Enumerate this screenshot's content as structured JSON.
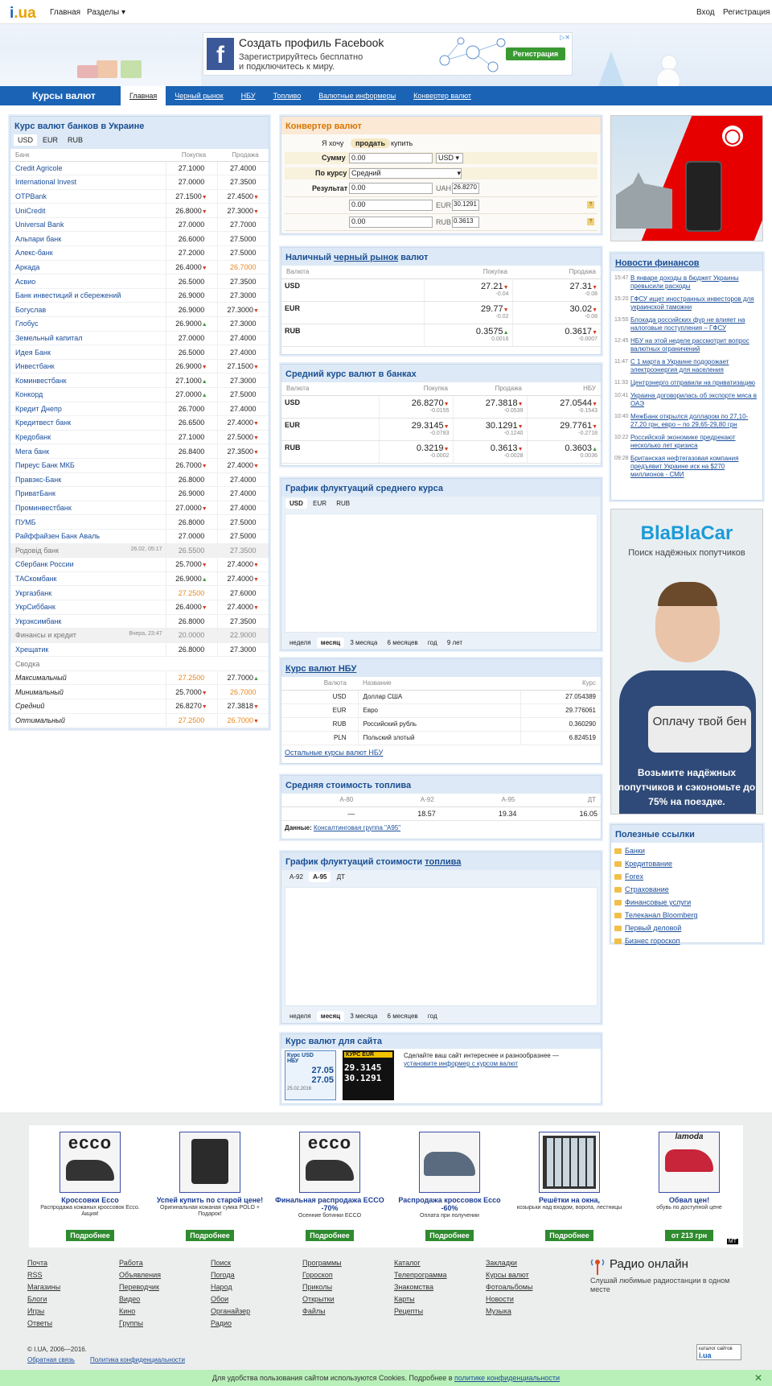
{
  "topbar": {
    "logo_i": "i",
    "logo_ua": ".ua",
    "home": "Главная",
    "sections": "Разделы ▾",
    "login": "Вход",
    "register": "Регистрация"
  },
  "banner": {
    "fb_title": "Создать профиль Facebook",
    "fb_line1": "Зарегистрируйтесь бесплатно",
    "fb_line2": "и подключитесь к миру.",
    "fb_button": "Регистрация",
    "fb_icon": "f"
  },
  "nav": {
    "section": "Курсы валют",
    "tabs": [
      "Главная",
      "Черный рынок",
      "НБУ",
      "Топливо",
      "Валютные информеры",
      "Конвертер валют"
    ]
  },
  "banks": {
    "title": "Курс валют банков в Украине",
    "currencies": [
      "USD",
      "EUR",
      "RUB"
    ],
    "col_bank": "Банк",
    "col_buy": "Покупка",
    "col_sell": "Продажа",
    "rows": [
      {
        "n": "Credit Agricole",
        "b": "27.1000",
        "s": "27.4000"
      },
      {
        "n": "International Invest",
        "b": "27.0000",
        "s": "27.3500"
      },
      {
        "n": "OTPBank",
        "b": "27.1500",
        "s": "27.4500",
        "bm": "dn",
        "sm": "dn"
      },
      {
        "n": "UniCredit",
        "b": "26.8000",
        "s": "27.3000",
        "bm": "dn",
        "sm": "dn"
      },
      {
        "n": "Universal Bank",
        "b": "27.0000",
        "s": "27.7000"
      },
      {
        "n": "Альпари банк",
        "b": "26.6000",
        "s": "27.5000"
      },
      {
        "n": "Алекс-банк",
        "b": "27.2000",
        "s": "27.5000"
      },
      {
        "n": "Аркада",
        "b": "26.4000",
        "s": "26.7000",
        "bm": "dn",
        "sc": "orange"
      },
      {
        "n": "Асвио",
        "b": "26.5000",
        "s": "27.3500"
      },
      {
        "n": "Банк инвестиций и сбережений",
        "b": "26.9000",
        "s": "27.3000"
      },
      {
        "n": "Богуслав",
        "b": "26.9000",
        "s": "27.3000",
        "sm": "dn"
      },
      {
        "n": "Глобус",
        "b": "26.9000",
        "s": "27.3000",
        "bm": "up"
      },
      {
        "n": "Земельный капитал",
        "b": "27.0000",
        "s": "27.4000"
      },
      {
        "n": "Идея Банк",
        "b": "26.5000",
        "s": "27.4000"
      },
      {
        "n": "Инвестбанк",
        "b": "26.9000",
        "s": "27.1500",
        "bm": "dn",
        "sm": "dn"
      },
      {
        "n": "Коминвестбанк",
        "b": "27.1000",
        "s": "27.3000",
        "bm": "up"
      },
      {
        "n": "Конкорд",
        "b": "27.0000",
        "s": "27.5000",
        "bm": "up"
      },
      {
        "n": "Кредит Днепр",
        "b": "26.7000",
        "s": "27.4000"
      },
      {
        "n": "Кредитвест банк",
        "b": "26.6500",
        "s": "27.4000",
        "sm": "dn"
      },
      {
        "n": "Кредобанк",
        "b": "27.1000",
        "s": "27.5000",
        "sm": "dn"
      },
      {
        "n": "Мега банк",
        "b": "26.8400",
        "s": "27.3500",
        "sm": "dn"
      },
      {
        "n": "Пиреус Банк МКБ",
        "b": "26.7000",
        "s": "27.4000",
        "bm": "dn",
        "sm": "dn"
      },
      {
        "n": "Правэкс-Банк",
        "b": "26.8000",
        "s": "27.4000"
      },
      {
        "n": "ПриватБанк",
        "b": "26.9000",
        "s": "27.4000"
      },
      {
        "n": "Проминвестбанк",
        "b": "27.0000",
        "s": "27.4000",
        "bm": "dn"
      },
      {
        "n": "ПУМБ",
        "b": "26.8000",
        "s": "27.5000"
      },
      {
        "n": "Райффайзен Банк Аваль",
        "b": "27.0000",
        "s": "27.5000"
      },
      {
        "n": "Родовід банк",
        "b": "26.5500",
        "s": "27.3500",
        "gray": true,
        "date": "26.02, 05:17"
      },
      {
        "n": "Сбербанк России",
        "b": "25.7000",
        "s": "27.4000",
        "bm": "dn",
        "sm": "dn"
      },
      {
        "n": "ТАСкомбанк",
        "b": "26.9000",
        "s": "27.4000",
        "bm": "up",
        "sm": "dn"
      },
      {
        "n": "Укргазбанк",
        "b": "27.2500",
        "s": "27.6000",
        "bc": "orange"
      },
      {
        "n": "УкрСиббанк",
        "b": "26.4000",
        "s": "27.4000",
        "bm": "dn",
        "sm": "dn"
      },
      {
        "n": "Укрэксимбанк",
        "b": "26.8000",
        "s": "27.3500"
      },
      {
        "n": "Финансы и кредит",
        "b": "20.0000",
        "s": "22.9000",
        "gray": true,
        "date": "Вчера, 23:47"
      },
      {
        "n": "Хрещатик",
        "b": "26.8000",
        "s": "27.3000"
      }
    ],
    "summary_label": "Сводка",
    "summary": [
      {
        "n": "Максимальный",
        "b": "27.2500",
        "s": "27.7000",
        "bc": "orange",
        "sm": "up"
      },
      {
        "n": "Минимальный",
        "b": "25.7000",
        "s": "26.7000",
        "bm": "dn",
        "sc": "orange"
      },
      {
        "n": "Средний",
        "b": "26.8270",
        "s": "27.3818",
        "bm": "dn",
        "sm": "dn"
      },
      {
        "n": "Оптимальный",
        "b": "27.2500",
        "s": "26.7000",
        "bc": "orange",
        "sc": "orange",
        "sm": "dn"
      }
    ]
  },
  "converter": {
    "title": "Конвертер валют",
    "want": "Я хочу",
    "sell": "продать",
    "buy": "купить",
    "sum_label": "Сумму",
    "sum": "0.00",
    "sum_cur": "USD ▾",
    "rate_label": "По курсу",
    "rate": "Средний",
    "result_label": "Результат",
    "results": [
      {
        "v": "0.00",
        "c": "UAH",
        "r": "26.8270"
      },
      {
        "v": "0.00",
        "c": "EUR",
        "r": "30.1291",
        "q": "?"
      },
      {
        "v": "0.00",
        "c": "RUB",
        "r": "0.3613",
        "q": "?"
      }
    ]
  },
  "black": {
    "title_a": "Наличный ",
    "title_b": "черный рынок",
    "title_c": " валют",
    "col_cur": "Валюта",
    "col_buy": "Покупка",
    "col_sell": "Продажа",
    "rows": [
      {
        "c": "USD",
        "b": "27.21",
        "bd": "-0.04",
        "s": "27.31",
        "sd": "-0.08"
      },
      {
        "c": "EUR",
        "b": "29.77",
        "bd": "-0.02",
        "s": "30.02",
        "sd": "-0.08"
      },
      {
        "c": "RUB",
        "b": "0.3575",
        "bd": "0.0016",
        "s": "0.3617",
        "sd": "-0.0007"
      }
    ]
  },
  "avg": {
    "title": "Средний курс валют в банках",
    "col_cur": "Валюта",
    "col_buy": "Покупка",
    "col_sell": "Продажа",
    "col_nbu": "НБУ",
    "rows": [
      {
        "c": "USD",
        "b": "26.8270",
        "bd": "-0.0155",
        "s": "27.3818",
        "sd": "-0.0539",
        "n": "27.0544",
        "nd": "-0.1543"
      },
      {
        "c": "EUR",
        "b": "29.3145",
        "bd": "-0.0783",
        "s": "30.1291",
        "sd": "-0.1240",
        "n": "29.7761",
        "nd": "-0.2718"
      },
      {
        "c": "RUB",
        "b": "0.3219",
        "bd": "-0.0002",
        "s": "0.3613",
        "sd": "-0.0028",
        "n": "0.3603",
        "nd": "0.0036"
      }
    ]
  },
  "graph1": {
    "title": "График флуктуаций среднего курса",
    "tabs": [
      "USD",
      "EUR",
      "RUB"
    ],
    "periods": [
      "неделя",
      "месяц",
      "3 месяца",
      "6 месяцев",
      "год",
      "9 лет"
    ]
  },
  "nbu": {
    "title": "Курс валют НБУ",
    "col_cur": "Валюта",
    "col_name": "Название",
    "col_rate": "Курс",
    "rows": [
      {
        "c": "USD",
        "n": "Доллар США",
        "r": "27.054389"
      },
      {
        "c": "EUR",
        "n": "Евро",
        "r": "29.776061"
      },
      {
        "c": "RUB",
        "n": "Российский рубль",
        "r": "0.360290"
      },
      {
        "c": "PLN",
        "n": "Польский злотый",
        "r": "6.824519"
      }
    ],
    "more": "Остальные курсы валют НБУ"
  },
  "fuel": {
    "title": "Средняя стоимость топлива",
    "cols": [
      "А-80",
      "А-92",
      "А-95",
      "ДТ"
    ],
    "vals": [
      "—",
      "18.57",
      "19.34",
      "16.05"
    ],
    "source_label": "Данные:",
    "source": "Консалтинговая группа \"А95\""
  },
  "graph2": {
    "title_a": "График флуктуаций стоимости ",
    "title_b": "топлива",
    "tabs": [
      "А-92",
      "А-95",
      "ДТ"
    ],
    "periods": [
      "неделя",
      "месяц",
      "3 месяца",
      "6 месяцев",
      "год"
    ]
  },
  "informer": {
    "title": "Курс валют для сайта",
    "text": "Сделайте ваш сайт интереснее и разнообразнее —",
    "link": "установите информер с курсом валют",
    "w1_title": "Курс USD НБУ",
    "w1_v1": "27.05",
    "w1_v2": "27.05",
    "w1_date": "25.02.2016",
    "w2_title": "КУРС EUR",
    "w2_v1": "29.3145",
    "w2_v2": "30.1291"
  },
  "news": {
    "title": "Новости финансов",
    "items": [
      {
        "t": "15:47",
        "h": "В январе доходы в бюджет Украины превысили расходы"
      },
      {
        "t": "15:20",
        "h": "ГФСУ ищет иностранных инвесторов для украинской таможни"
      },
      {
        "t": "13:55",
        "h": "Блокада российских фур не влияет на налоговые поступления – ГФСУ"
      },
      {
        "t": "12:45",
        "h": "НБУ на этой неделе рассмотрит вопрос валютных ограничений"
      },
      {
        "t": "11:47",
        "h": "С 1 марта в Украине подорожает электроэнергия для населения"
      },
      {
        "t": "11:33",
        "h": "Центрэнерго отправили на приватизацию"
      },
      {
        "t": "10:41",
        "h": "Украина договорилась об экспорте мяса в ОАЭ"
      },
      {
        "t": "10:40",
        "h": "МежБанк открылся долларом по 27,10-27,20 грн, евро – по 29,65-29,80 грн"
      },
      {
        "t": "10:22",
        "h": "Российской экономике предрекают несколько лет кризиса"
      },
      {
        "t": "09:28",
        "h": "Британская нефтегазовая компания предъявит Украине иск на $270 миллионов - СМИ"
      }
    ]
  },
  "blabla": {
    "logo": "BlaBlaCar",
    "tag": "Поиск надёжных попутчиков",
    "pay": "Оплачу твой бен",
    "text": "Возьмите надёжных попутчиков и сэкономьте до 75% на поездке."
  },
  "links": {
    "title": "Полезные ссылки",
    "items": [
      "Банки",
      "Кредитование",
      "Forex",
      "Страхование",
      "Финансовые услуги",
      "Телеканал Bloomberg",
      "Первый деловой",
      "Бизнес гороскоп"
    ]
  },
  "shop": [
    {
      "img": "ecco",
      "name": "Кроссовки Ecco",
      "desc": "Распродажа кожаных кроссовок Ecco. Акция!",
      "btn": "Подробнее"
    },
    {
      "img": "bag",
      "name": "Успей купить по старой цене!",
      "desc": "Оригинальная кожаная сумка POLO + Подарок!",
      "btn": "Подробнее"
    },
    {
      "img": "ecco",
      "name": "Финальная распродажа ECCO -70%",
      "desc": "Осенние ботинки ECCO",
      "btn": "Подробнее"
    },
    {
      "img": "shoe",
      "name": "Распродажа кроссовок Ecco -60%",
      "desc": "Оплата при получении",
      "btn": "Подробнее"
    },
    {
      "img": "grill",
      "name": "Решётки на окна,",
      "desc": "козырьки над входом, ворота, лестницы",
      "btn": "Подробнее"
    },
    {
      "img": "lamoda",
      "name": "Обвал цен!",
      "desc": "обувь по доступной цене",
      "btn": "от 213 грн"
    }
  ],
  "footer": {
    "cols": [
      [
        "Почта",
        "RSS",
        "Магазины",
        "Блоги",
        "Игры",
        "Ответы"
      ],
      [
        "Работа",
        "Объявления",
        "Переводчик",
        "Видео",
        "Кино",
        "Группы"
      ],
      [
        "Поиск",
        "Погода",
        "Народ",
        "Обои",
        "Органайзер",
        "Радио"
      ],
      [
        "Программы",
        "Гороскоп",
        "Приколы",
        "Открытки",
        "Файлы"
      ],
      [
        "Каталог",
        "Телепрограмма",
        "Знакомства",
        "Карты",
        "Рецепты"
      ],
      [
        "Закладки",
        "Курсы валют",
        "Фотоальбомы",
        "Новости",
        "Музыка"
      ]
    ],
    "radio_title": "Радио онлайн",
    "radio_text": "Слушай любимые радиостанции в одном месте",
    "copy": "© I.UA, 2006—2016.",
    "feedback": "Обратная связь",
    "privacy": "Политика конфиденциальности",
    "cat": "каталог сайтов",
    "cat_logo": "i.ua",
    "ad": "MT"
  },
  "cookie": {
    "text": "Для удобства пользования сайтом используются Cookies. Подробнее в ",
    "link": "политике конфиденциальности",
    "close": "✕"
  },
  "vodafone": {
    "logo": "◯"
  }
}
